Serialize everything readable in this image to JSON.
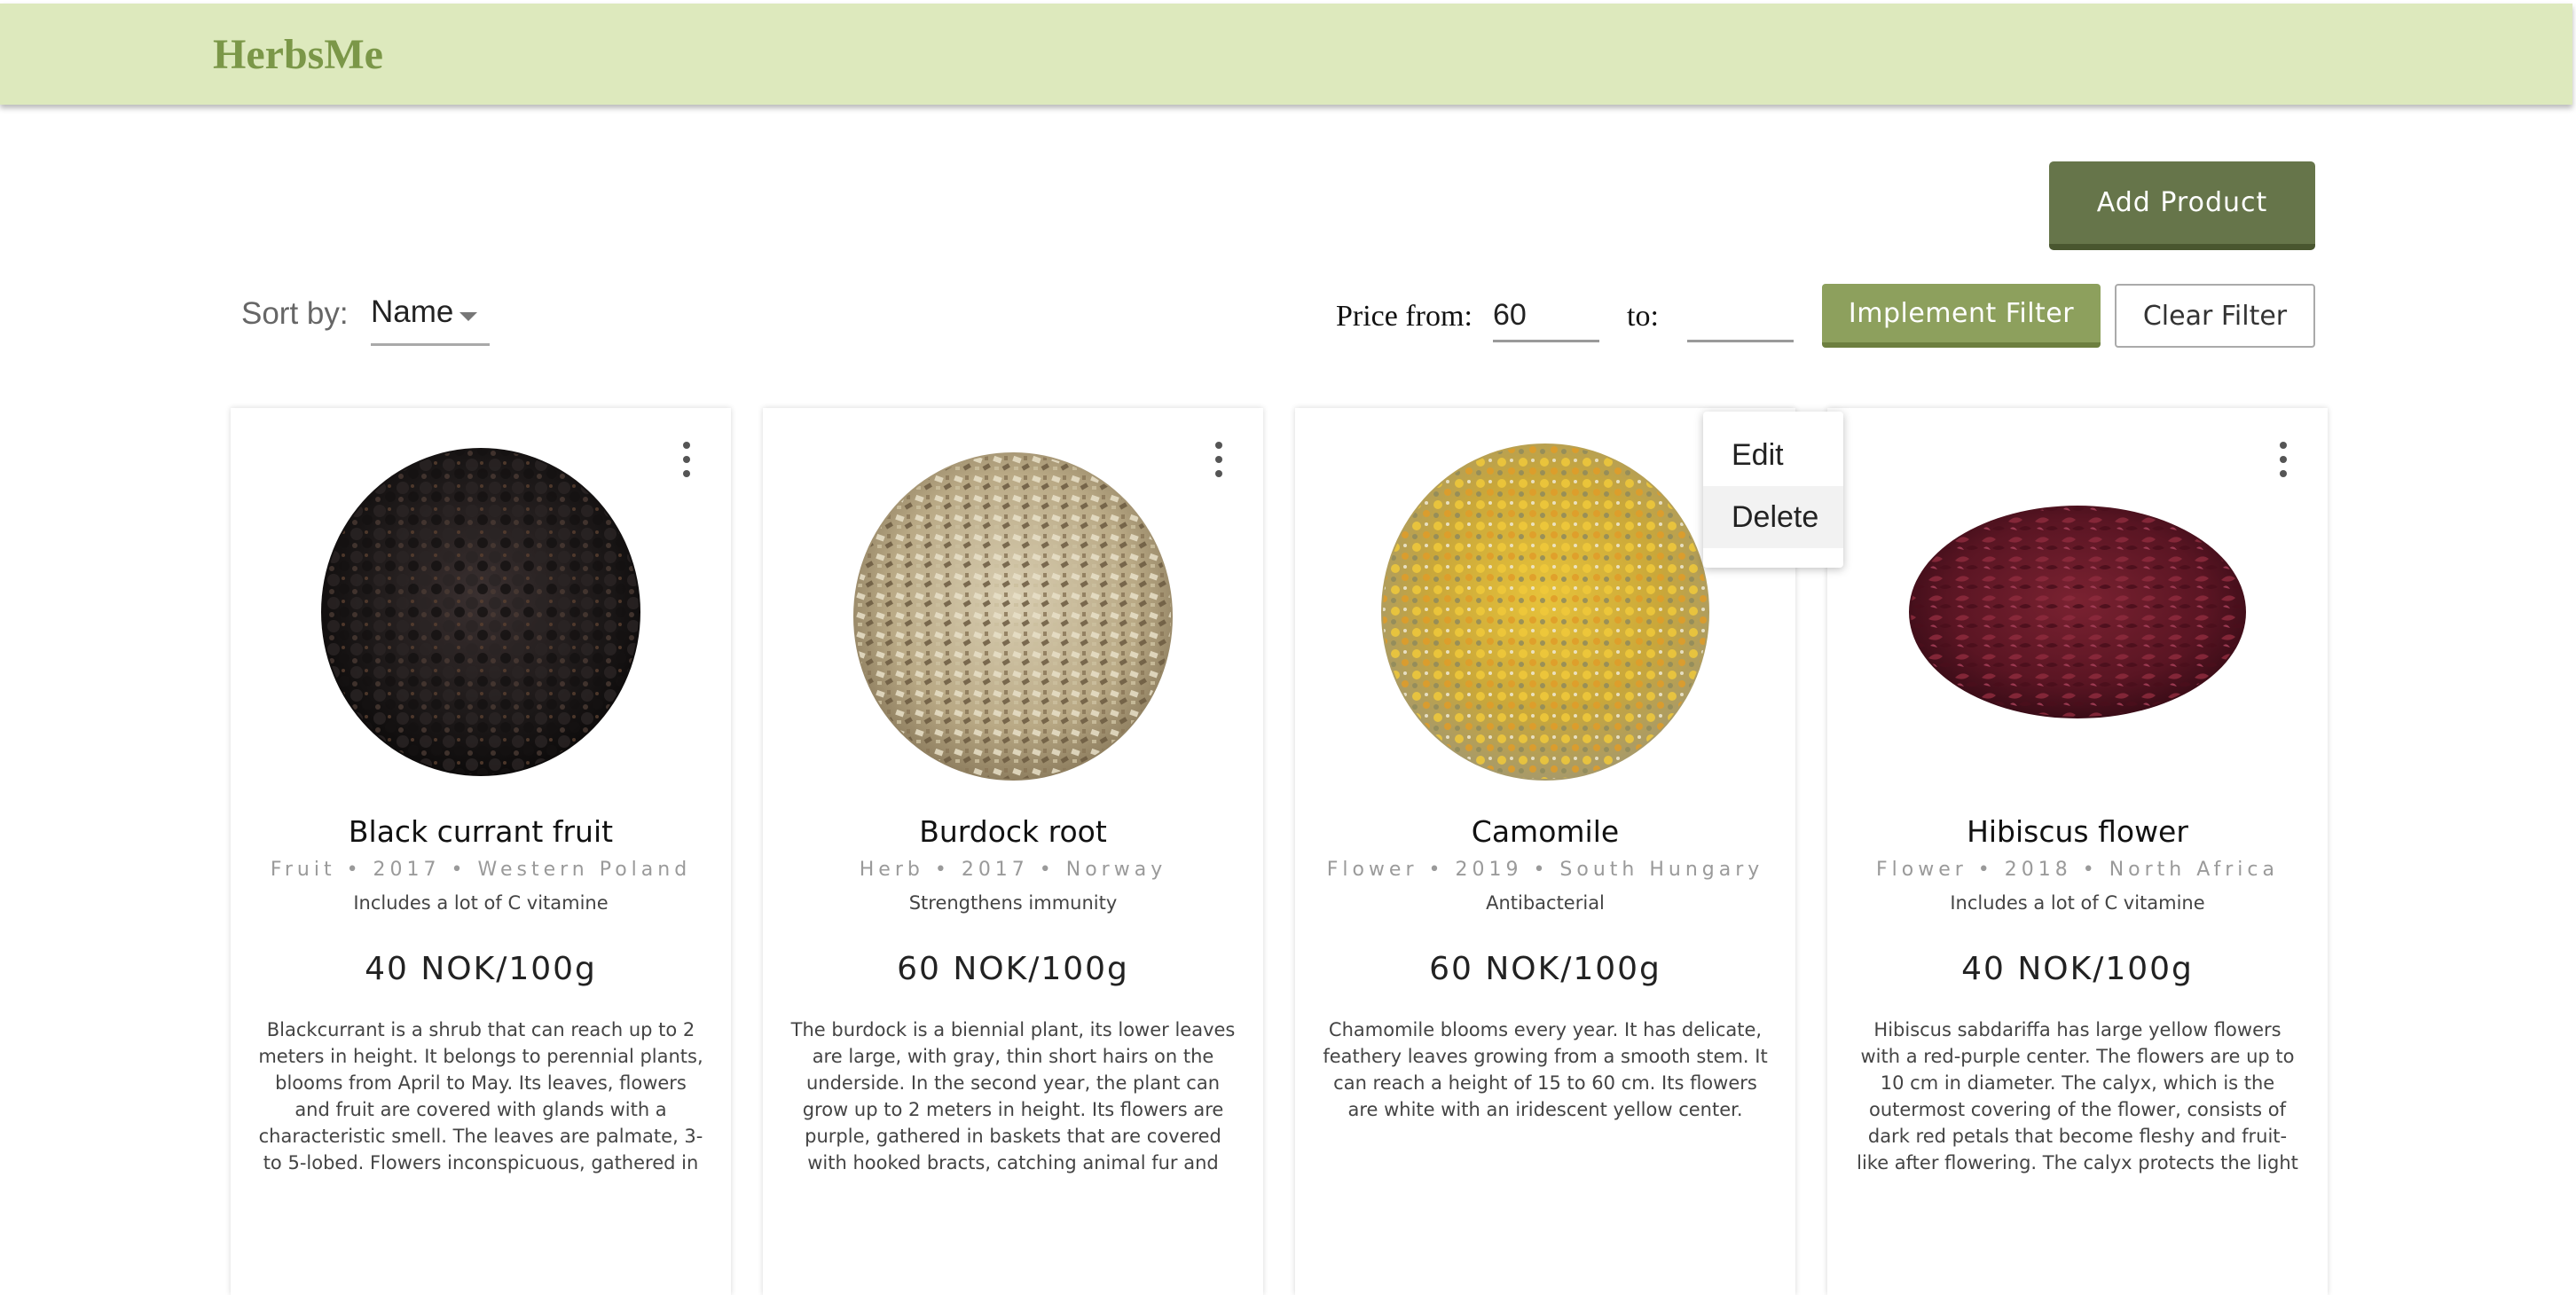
{
  "header": {
    "brand": "HerbsMe"
  },
  "toolbar": {
    "add_product_label": "Add Product",
    "sort_label": "Sort by:",
    "sort_value": "Name",
    "price_from_label": "Price from:",
    "price_from_value": "60",
    "price_to_label": "to:",
    "price_to_value": "",
    "implement_filter_label": "Implement Filter",
    "clear_filter_label": "Clear Filter"
  },
  "context_menu": {
    "items": [
      {
        "label": "Edit"
      },
      {
        "label": "Delete"
      }
    ]
  },
  "products": [
    {
      "name": "Black currant fruit",
      "meta": "Fruit • 2017 • Western Poland",
      "tag": "Includes a lot of C vitamine",
      "price": "40 NOK/100g",
      "description": "Blackcurrant is a shrub that can reach up to 2 meters in height. It belongs to perennial plants, blooms from April to May. Its leaves, flowers and fruit are covered with glands with a characteristic smell. The leaves are palmate, 3-to 5-lobed. Flowers inconspicuous, gathered in multiflorous clusters. The fruit is a black, fleshy,",
      "image_icon": "black-currant-image"
    },
    {
      "name": "Burdock root",
      "meta": "Herb • 2017 • Norway",
      "tag": "Strengthens immunity",
      "price": "60 NOK/100g",
      "description": "The burdock is a biennial plant, its lower leaves are large, with gray, thin short hairs on the underside. In the second year, the plant can grow up to 2 meters in height. Its flowers are purple, gathered in baskets that are covered with hooked bracts, catching animal fur and clothing. The root can grow quite deep, about",
      "image_icon": "burdock-root-image"
    },
    {
      "name": "Camomile",
      "meta": "Flower • 2019 • South Hungary",
      "tag": "Antibacterial",
      "price": "60 NOK/100g",
      "description": "Chamomile blooms every year. It has delicate, feathery leaves growing from a smooth stem. It can reach a height of 15 to 60 cm. Its flowers are white with an iridescent yellow center.",
      "image_icon": "camomile-image"
    },
    {
      "name": "Hibiscus flower",
      "meta": "Flower • 2018 • North Africa",
      "tag": "Includes a lot of C vitamine",
      "price": "40 NOK/100g",
      "description": "Hibiscus sabdariffa has large yellow flowers with a red-purple center. The flowers are up to 10 cm in diameter. The calyx, which is the outermost covering of the flower, consists of dark red petals that become fleshy and fruit-like after flowering. The calyx protects the light green to brown fruit that develops inside and matures.",
      "image_icon": "hibiscus-image"
    }
  ],
  "colors": {
    "header_bg": "#dde9bd",
    "brand": "#7b9748",
    "add_button": "#66754a",
    "implement_button": "#8da05d"
  }
}
